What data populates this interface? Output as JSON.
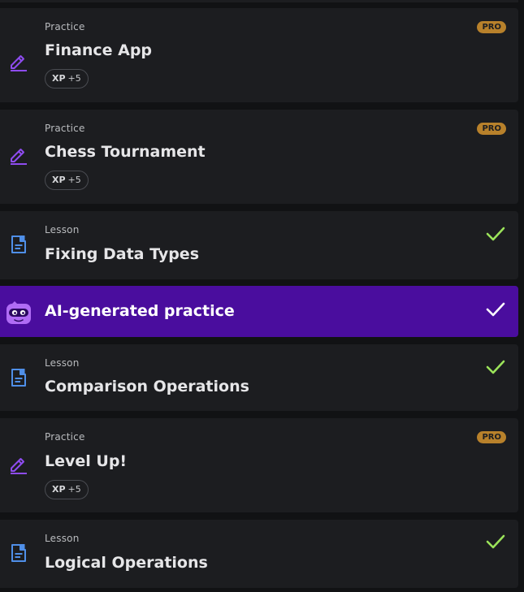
{
  "items": [
    {
      "kind": "practice",
      "type_label": "Practice",
      "title": "Finance App",
      "xp_label": "XP",
      "xp_value": "+5",
      "badge": "PRO"
    },
    {
      "kind": "practice",
      "type_label": "Practice",
      "title": "Chess Tournament",
      "xp_label": "XP",
      "xp_value": "+5",
      "badge": "PRO"
    },
    {
      "kind": "lesson",
      "type_label": "Lesson",
      "title": "Fixing Data Types",
      "completed": true
    },
    {
      "kind": "ai",
      "title": "AI-generated practice",
      "completed": true
    },
    {
      "kind": "lesson",
      "type_label": "Lesson",
      "title": "Comparison Operations",
      "completed": true
    },
    {
      "kind": "practice",
      "type_label": "Practice",
      "title": "Level Up!",
      "xp_label": "XP",
      "xp_value": "+5",
      "badge": "PRO"
    },
    {
      "kind": "lesson",
      "type_label": "Lesson",
      "title": "Logical Operations",
      "completed": true
    }
  ],
  "colors": {
    "card_bg": "#1c1d20",
    "ai_bg": "#4a0d9e",
    "pro_badge": "#b8812b",
    "check_green": "#9be35a",
    "practice_icon": "#8e4cf0",
    "lesson_icon": "#4f8fe8"
  },
  "icons": {
    "practice": "pencil-icon",
    "lesson": "document-icon",
    "ai": "robot-mascot-icon",
    "completed": "check-icon"
  }
}
